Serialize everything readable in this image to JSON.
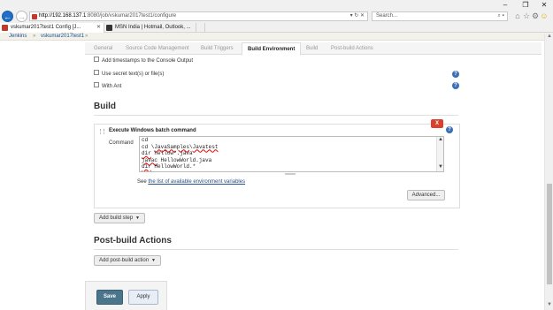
{
  "browser": {
    "window_controls": [
      "–",
      "❐",
      "✕"
    ],
    "url_host": "http://192.168.137.1",
    "url_path": ":8080/job/vskumar2017test1/configure",
    "url_controls": "▾ ↻ ✕",
    "search_placeholder": "Search...",
    "search_controls": "⌕ ▾",
    "toolbar_icons": [
      "⌂",
      "☆",
      "⚙",
      "☺"
    ],
    "tabs": [
      {
        "title": "vskumar2017test1 Config [J...",
        "close": "✕",
        "icon_color": "#c0392b"
      },
      {
        "title": "MSN India | Hotmail, Outlook, ...",
        "close": "",
        "icon_color": "#333333"
      }
    ]
  },
  "breadcrumb": {
    "items": [
      "Jenkins",
      "vskumar2017test1"
    ],
    "separator": "»"
  },
  "config_tabs": [
    {
      "label": "General",
      "active": false
    },
    {
      "label": "Source Code Management",
      "active": false
    },
    {
      "label": "Build Triggers",
      "active": false
    },
    {
      "label": "Build Environment",
      "active": true
    },
    {
      "label": "Build",
      "active": false
    },
    {
      "label": "Post-build Actions",
      "active": false
    }
  ],
  "build_env_options": [
    {
      "label": "Add timestamps to the Console Output",
      "checked": false,
      "help": false
    },
    {
      "label": "Use secret text(s) or file(s)",
      "checked": false,
      "help": true
    },
    {
      "label": "With Ant",
      "checked": false,
      "help": true
    }
  ],
  "help_glyph": "?",
  "build": {
    "title": "Build",
    "step": {
      "title": "Execute Windows batch command",
      "delete_label": "X",
      "command_label": "Command",
      "command_lines": [
        {
          "segments": [
            {
              "t": "cd",
              "sq": false
            }
          ]
        },
        {
          "segments": [
            {
              "t": "cd \\",
              "sq": false
            },
            {
              "t": "JavaSamples",
              "sq": true
            },
            {
              "t": "\\",
              "sq": false
            },
            {
              "t": "Javatest",
              "sq": true
            }
          ]
        },
        {
          "segments": [
            {
              "t": "dir",
              "sq": true
            },
            {
              "t": " hellow*.java",
              "sq": false
            }
          ]
        },
        {
          "segments": [
            {
              "t": "javac",
              "sq": true
            },
            {
              "t": " HellowWorld.java",
              "sq": false
            }
          ]
        },
        {
          "segments": [
            {
              "t": "dir",
              "sq": true
            },
            {
              "t": " HellowWorld.*",
              "sq": false
            }
          ]
        }
      ],
      "scroll_up": "▲",
      "scroll_down": "▼",
      "see_prefix": "See ",
      "see_link": "the list of available environment variables",
      "advanced_label": "Advanced..."
    },
    "add_step_label": "Add build step"
  },
  "post_build": {
    "title": "Post-build Actions",
    "add_action_label": "Add post-build action"
  },
  "caret": "▼",
  "footer": {
    "save_label": "Save",
    "apply_label": "Apply"
  },
  "page_scroll": {
    "up": "▲",
    "down": "▼"
  }
}
